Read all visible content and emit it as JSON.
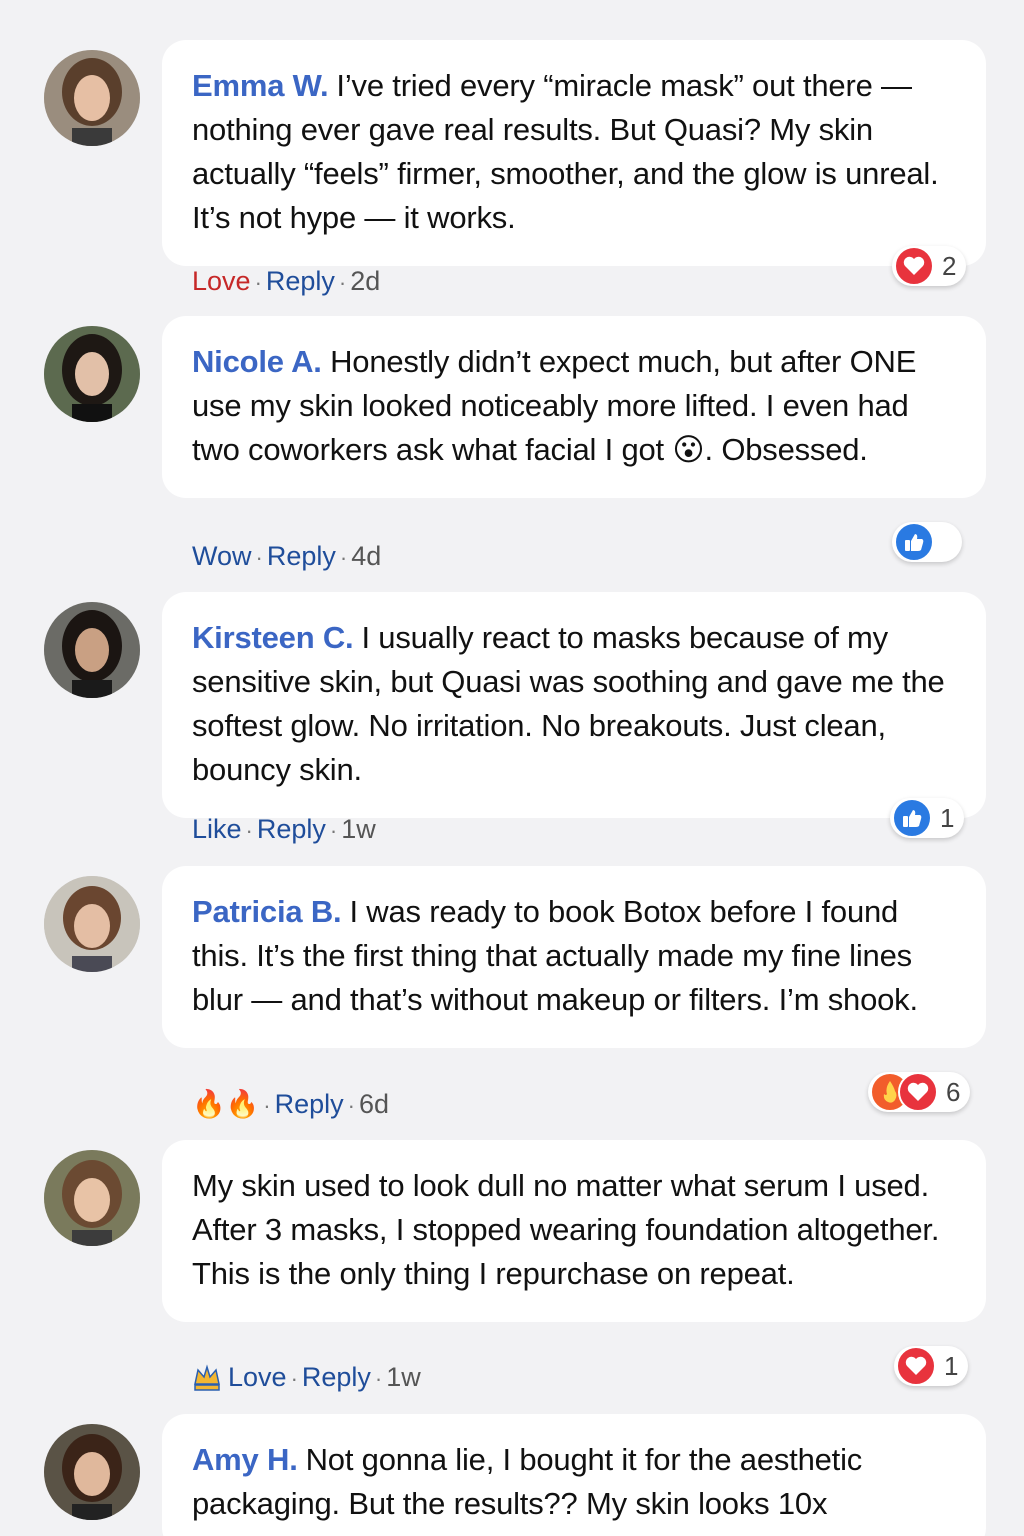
{
  "comments": [
    {
      "author": "Emma W.",
      "text": "I’ve tried every “miracle mask” out there — nothing ever gave real results. But Quasi? My skin actually “feels” firmer, smoother, and the glow is unreal. It’s not hype — it works.",
      "action_reaction": "Love",
      "reply": "Reply",
      "time": "2d",
      "reaction_count": "2",
      "reaction_icons": [
        "heart-icon"
      ]
    },
    {
      "author": "Nicole A.",
      "text": "Honestly didn’t expect much, but after ONE use my skin looked noticeably more lifted. I even had two coworkers ask what facial I got 😮. Obsessed.",
      "action_reaction": "Wow",
      "reply": "Reply",
      "time": "4d",
      "reaction_count": "",
      "reaction_icons": [
        "thumbs-up-icon"
      ]
    },
    {
      "author": "Kirsteen C.",
      "text": "I usually react to masks because of my sensitive skin, but Quasi was soothing and gave me the softest glow. No irritation. No breakouts. Just clean, bouncy skin.",
      "action_reaction": "Like",
      "reply": "Reply",
      "time": "1w",
      "reaction_count": "1",
      "reaction_icons": [
        "thumbs-up-icon"
      ]
    },
    {
      "author": "Patricia B.",
      "text": "I was ready to book Botox before I found this. It’s the first thing that actually made my fine lines blur — and that’s without makeup or filters. I’m shook.",
      "action_reaction": "🔥🔥",
      "reply": "Reply",
      "time": "6d",
      "reaction_count": "6",
      "reaction_icons": [
        "fire-icon",
        "heart-icon"
      ]
    },
    {
      "author": "",
      "text": "My skin used to look dull no matter what serum I used. After 3 masks, I stopped wearing foundation altogether. This is the only thing I repurchase on repeat.",
      "action_reaction": "Love",
      "reply": "Reply",
      "time": "1w",
      "reaction_count": "1",
      "reaction_icons": [
        "heart-icon"
      ]
    },
    {
      "author": "Amy H.",
      "text": "Not gonna lie, I bought it for the aesthetic packaging. But the results?? My skin looks 10x",
      "action_reaction": "",
      "reply": "",
      "time": "",
      "reaction_count": "",
      "reaction_icons": []
    }
  ],
  "colors": {
    "background": "#f2f2f4",
    "bubble": "#ffffff",
    "author": "#3b66c4",
    "action_link": "#1f4d9a",
    "love": "#c62828",
    "heart": "#e8333d",
    "like": "#2a7ae2"
  }
}
